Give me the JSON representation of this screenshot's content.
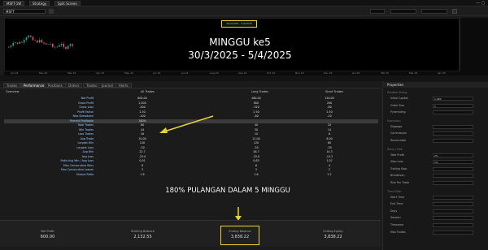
{
  "top_tabs": [
    "MSFT-1W",
    "Strategy",
    "Split Screen"
  ],
  "symbol": "MSFT",
  "chart": {
    "title_line1": "MINGGU ke5",
    "title_line2": "30/3/2025 - 5/4/2025",
    "badge_text": "30/3/2025 - 5/4/2025",
    "time_ticks": [
      "Jan 24",
      "Feb 24",
      "Mar 24",
      "Apr 24",
      "May 24",
      "Jun 24",
      "Jul 24",
      "Aug 24",
      "Sep 24",
      "Oct 24",
      "Nov 24",
      "Dec 24",
      "Jan 25",
      "Feb 25",
      "Mar 25",
      "Apr 25"
    ]
  },
  "subtabs": [
    "Trades",
    "Performance",
    "Positions",
    "Orders",
    "Trades",
    "Journal",
    "Alerts"
  ],
  "table": {
    "headers": [
      "Overview",
      "All Trades",
      "Long Trades",
      "Short Trades"
    ],
    "rows": [
      {
        "label": "Net Profit",
        "all": "600.00",
        "long": "480.00",
        "short": "120.00"
      },
      {
        "label": "Gross Profit",
        "all": "1,000",
        "long": "800",
        "short": "200"
      },
      {
        "label": "Gross Loss",
        "all": "-400",
        "long": "-320",
        "short": "-80"
      },
      {
        "label": "Profit Factor",
        "all": "2.50",
        "long": "2.50",
        "short": "2.50"
      },
      {
        "label": "Max Drawdown",
        "all": "-100",
        "long": "-80",
        "short": "-20"
      },
      {
        "label": "Percent Profitable",
        "all": "180%",
        "long": "",
        "short": "",
        "highlight": true
      },
      {
        "label": "Total Trades",
        "all": "60",
        "long": "40",
        "short": "20"
      },
      {
        "label": "Win Trades",
        "all": "44",
        "long": "30",
        "short": "14"
      },
      {
        "label": "Loss Trades",
        "all": "16",
        "long": "10",
        "short": "6"
      },
      {
        "label": "Avg Trade",
        "all": "10.00",
        "long": "12.00",
        "short": "6.00"
      },
      {
        "label": "Largest Win",
        "all": "120",
        "long": "120",
        "short": "60"
      },
      {
        "label": "Largest Loss",
        "all": "-50",
        "long": "-50",
        "short": "-30"
      },
      {
        "label": "Avg Win",
        "all": "22.7",
        "long": "26.7",
        "short": "14.3"
      },
      {
        "label": "Avg Loss",
        "all": "-25.0",
        "long": "-32.0",
        "short": "-13.3"
      },
      {
        "label": "Ratio Avg Win / Avg Loss",
        "all": "0.91",
        "long": "0.83",
        "short": "1.07"
      },
      {
        "label": "Max Consecutive Wins",
        "all": "8",
        "long": "6",
        "short": "4"
      },
      {
        "label": "Max Consecutive Losses",
        "all": "3",
        "long": "2",
        "short": "2"
      },
      {
        "label": "Sharpe Ratio",
        "all": "1.8",
        "long": "1.6",
        "short": "1.2"
      }
    ]
  },
  "banner": "180% PULANGAN DALAM 5 MINGGU",
  "bottom": [
    {
      "label": "Net Profit",
      "value": "600.00"
    },
    {
      "label": "Starting Balance",
      "value": "2,132.55"
    },
    {
      "label": "Ending Balance",
      "value": "3,838.22"
    },
    {
      "label": "Ending Equity",
      "value": "3,838.22"
    }
  ],
  "right_panel": {
    "header": "Properties",
    "sections": [
      {
        "title": "Position Sizing",
        "items": [
          {
            "label": "Initial Capital",
            "value": "1,000"
          },
          {
            "label": "Order Size",
            "value": "1"
          },
          {
            "label": "Pyramiding",
            "value": ""
          }
        ]
      },
      {
        "title": "Execution",
        "items": [
          {
            "label": "Slippage",
            "value": ""
          },
          {
            "label": "Commission",
            "value": ""
          },
          {
            "label": "Recalculate",
            "value": ""
          }
        ]
      },
      {
        "title": "Entry / Exit",
        "items": [
          {
            "label": "Take Profit",
            "value": "2%"
          },
          {
            "label": "Stop Loss",
            "value": "1%"
          },
          {
            "label": "Trailing Stop",
            "value": ""
          },
          {
            "label": "Breakeven",
            "value": ""
          },
          {
            "label": "Risk Per Trade",
            "value": ""
          }
        ]
      },
      {
        "title": "Time Filter",
        "items": [
          {
            "label": "Start Time",
            "value": ""
          },
          {
            "label": "End Time",
            "value": ""
          },
          {
            "label": "Days",
            "value": ""
          },
          {
            "label": "Session",
            "value": ""
          },
          {
            "label": "Timezone",
            "value": ""
          },
          {
            "label": "Max Trades",
            "value": ""
          }
        ]
      }
    ]
  },
  "colors": {
    "accent": "#e8d335",
    "bull": "#26a69a",
    "bear": "#ef5350"
  }
}
